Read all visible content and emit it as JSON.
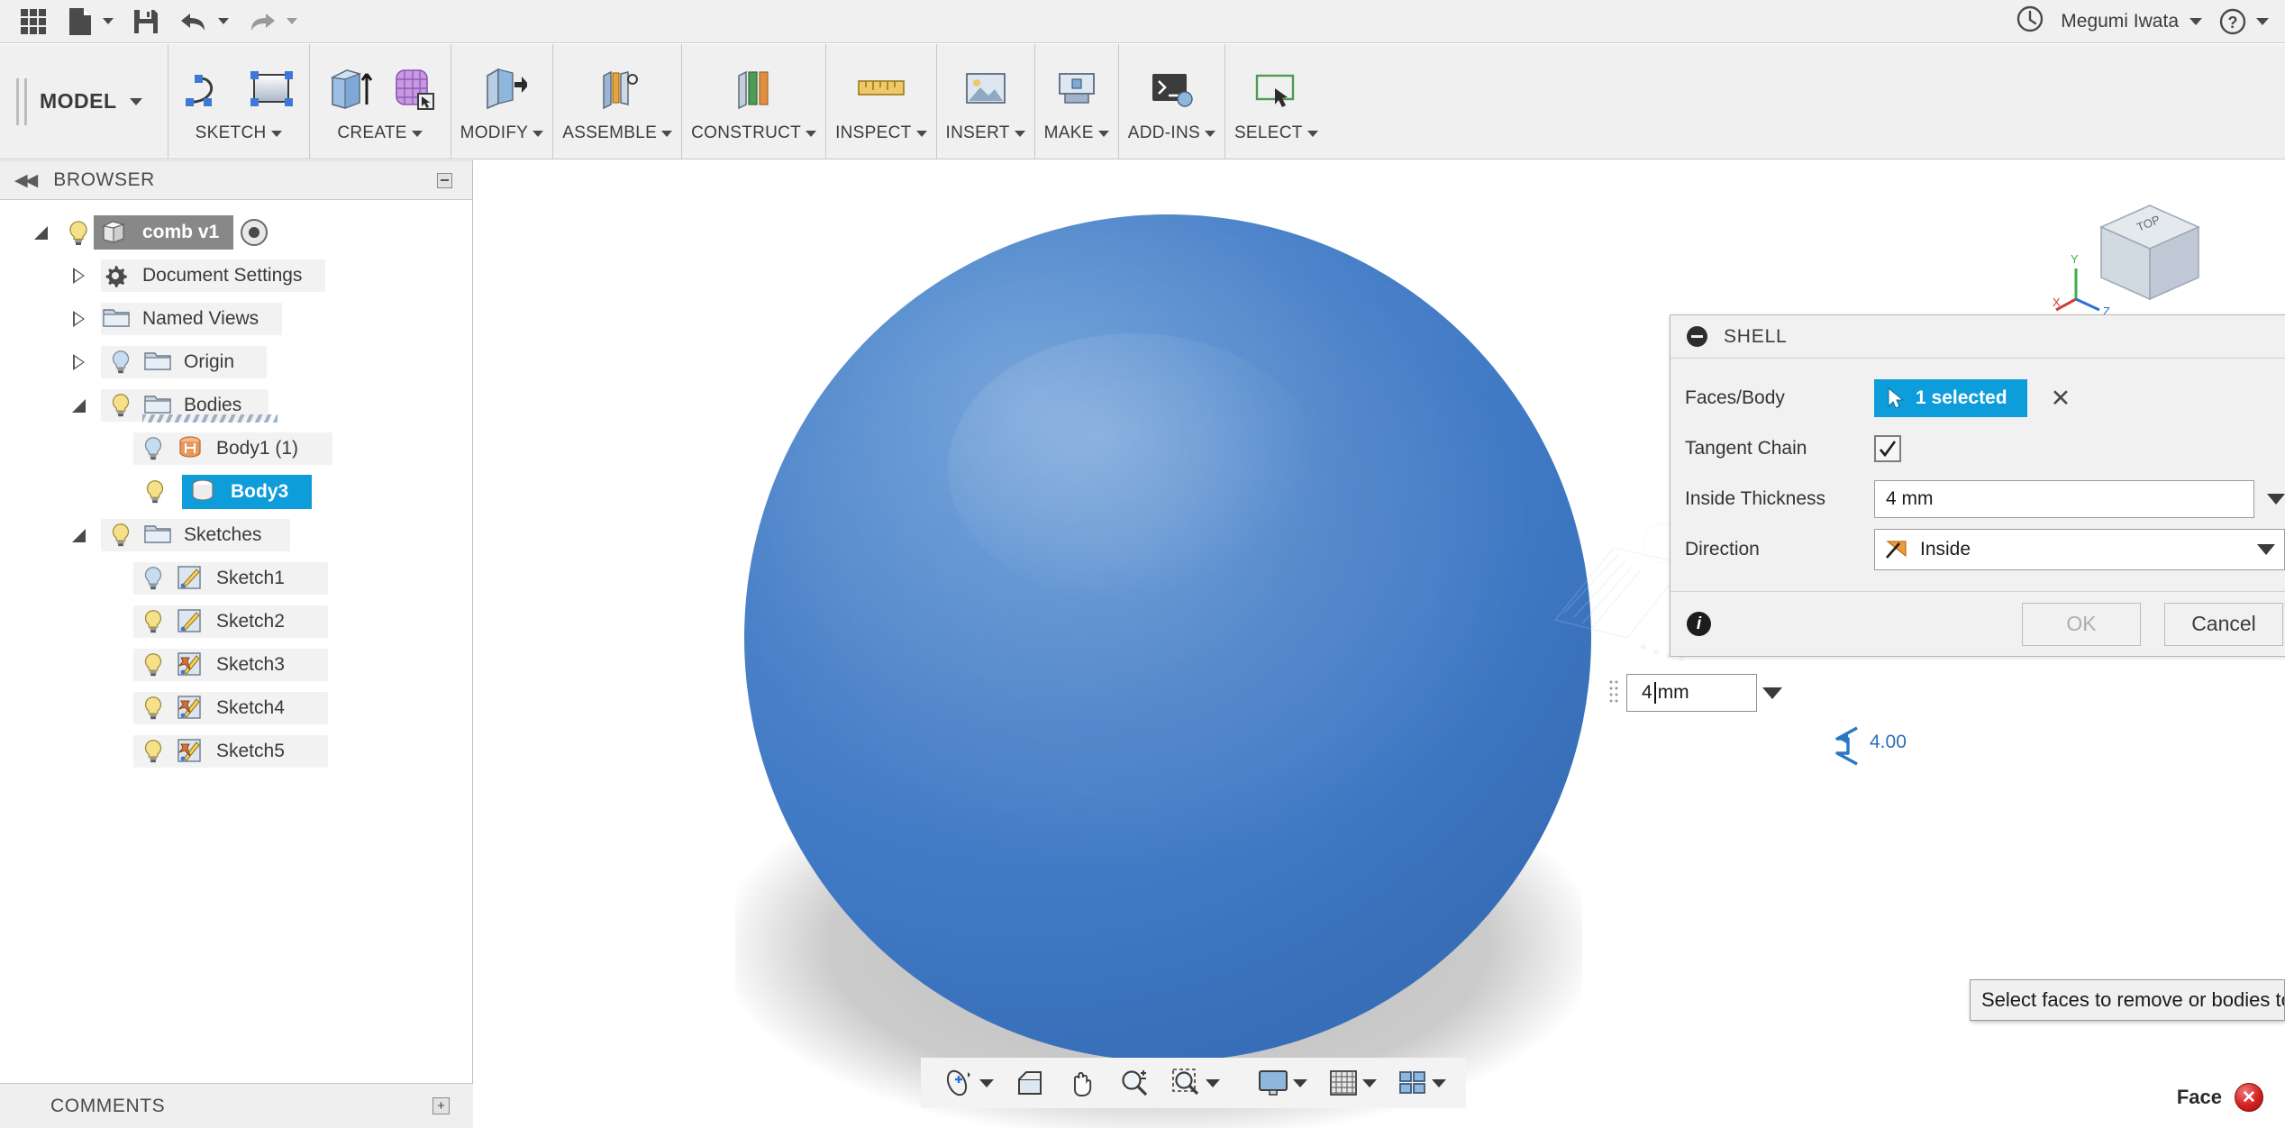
{
  "qat": {
    "grid_icon": "grid-apps-icon",
    "new_icon": "new-document-icon",
    "save_icon": "save-icon",
    "undo_icon": "undo-icon",
    "redo_icon": "redo-icon",
    "history_icon": "clock-history-icon",
    "help_icon": "help-icon",
    "user_name": "Megumi Iwata"
  },
  "ribbon": {
    "workspace_label": "MODEL",
    "groups": [
      {
        "label": "SKETCH",
        "icons": [
          "spline-icon",
          "rectangle-icon"
        ]
      },
      {
        "label": "CREATE",
        "icons": [
          "extrude-icon",
          "mesh-box-icon"
        ]
      },
      {
        "label": "MODIFY",
        "icons": [
          "press-pull-icon"
        ]
      },
      {
        "label": "ASSEMBLE",
        "icons": [
          "joint-icon"
        ]
      },
      {
        "label": "CONSTRUCT",
        "icons": [
          "offset-plane-icon"
        ]
      },
      {
        "label": "INSPECT",
        "icons": [
          "measure-icon"
        ]
      },
      {
        "label": "INSERT",
        "icons": [
          "insert-image-icon"
        ]
      },
      {
        "label": "MAKE",
        "icons": [
          "3d-print-icon"
        ]
      },
      {
        "label": "ADD-INS",
        "icons": [
          "script-icon"
        ]
      },
      {
        "label": "SELECT",
        "icons": [
          "select-icon"
        ]
      }
    ]
  },
  "browser": {
    "title": "BROWSER",
    "collapse_icon": "collapse-left-icon",
    "pin_icon": "minimize-icon",
    "root": {
      "label": "comb v1",
      "icon": "body-cube-icon",
      "bulb": "lightbulb-on-icon",
      "expanded": true
    },
    "items": [
      {
        "label": "Document Settings",
        "icon": "gear-icon",
        "indent": 1,
        "expander": "closed",
        "bulb": false
      },
      {
        "label": "Named Views",
        "icon": "folder-icon",
        "indent": 1,
        "expander": "closed",
        "bulb": false
      },
      {
        "label": "Origin",
        "icon": "folder-icon",
        "indent": 1,
        "expander": "closed",
        "bulb": "lightbulb-off-icon"
      },
      {
        "label": "Bodies",
        "icon": "folder-icon",
        "indent": 1,
        "expander": "open",
        "bulb": "lightbulb-on-icon"
      },
      {
        "label": "Body1 (1)",
        "icon": "body-solid-orange-icon",
        "indent": 2,
        "expander": "none",
        "bulb": "lightbulb-off-icon"
      },
      {
        "label": "Body3",
        "icon": "body-solid-white-icon",
        "indent": 2,
        "expander": "none",
        "bulb": "lightbulb-on-icon",
        "selected": true
      },
      {
        "label": "Sketches",
        "icon": "folder-icon",
        "indent": 1,
        "expander": "open",
        "bulb": "lightbulb-on-icon"
      },
      {
        "label": "Sketch1",
        "icon": "sketch-icon",
        "indent": 2,
        "expander": "none",
        "bulb": "lightbulb-off-icon"
      },
      {
        "label": "Sketch2",
        "icon": "sketch-icon",
        "indent": 2,
        "expander": "none",
        "bulb": "lightbulb-on-icon"
      },
      {
        "label": "Sketch3",
        "icon": "sketch-pinned-icon",
        "indent": 2,
        "expander": "none",
        "bulb": "lightbulb-on-icon"
      },
      {
        "label": "Sketch4",
        "icon": "sketch-pinned-icon",
        "indent": 2,
        "expander": "none",
        "bulb": "lightbulb-on-icon"
      },
      {
        "label": "Sketch5",
        "icon": "sketch-pinned-icon",
        "indent": 2,
        "expander": "none",
        "bulb": "lightbulb-on-icon"
      }
    ],
    "comments_label": "COMMENTS",
    "comments_add_icon": "add-comment-icon"
  },
  "canvas": {
    "dimension_label": "4.00",
    "dimension_icon": "dimension-arrow-icon",
    "viewcube_icon": "view-cube-icon",
    "viewcube_top_label": "TOP",
    "axis_x": "X",
    "axis_y": "Y",
    "axis_z": "Z"
  },
  "shell_dialog": {
    "title": "SHELL",
    "collapse_icon": "minus-circle-icon",
    "faces_body_label": "Faces/Body",
    "faces_body_value": "1 selected",
    "faces_body_cursor_icon": "cursor-arrow-icon",
    "clear_icon": "clear-x-icon",
    "tangent_chain_label": "Tangent Chain",
    "tangent_chain_checked": true,
    "inside_thickness_label": "Inside Thickness",
    "inside_thickness_value": "4 mm",
    "direction_label": "Direction",
    "direction_value": "Inside",
    "direction_icon": "direction-inside-icon",
    "info_icon": "info-icon",
    "ok_label": "OK",
    "cancel_label": "Cancel",
    "ok_enabled": false
  },
  "value_input": {
    "value": "4",
    "unit": "mm",
    "grip_icon": "drag-grip-icon",
    "dropdown_icon": "chevron-down-icon"
  },
  "navbar": {
    "items": [
      {
        "icon": "orbit-icon",
        "caret": true
      },
      {
        "icon": "look-at-icon",
        "caret": false
      },
      {
        "icon": "pan-hand-icon",
        "caret": false
      },
      {
        "icon": "zoom-icon",
        "caret": false
      },
      {
        "icon": "zoom-window-icon",
        "caret": true
      },
      {
        "icon": "display-mode-icon",
        "caret": true
      },
      {
        "icon": "grid-snap-icon",
        "caret": true
      },
      {
        "icon": "viewports-icon",
        "caret": true
      }
    ]
  },
  "tooltip": {
    "text": "Select faces to remove or bodies to shell."
  },
  "status": {
    "face_label": "Face",
    "error_icon": "error-close-icon"
  },
  "colors": {
    "accent_blue": "#0d9ddb",
    "sphere_blue": "#3f79c4",
    "ribbon_bg": "#f0f0f0",
    "panel_bg": "#ffffff",
    "error_red": "#d32020",
    "dim_blue": "#2a6fb8"
  }
}
